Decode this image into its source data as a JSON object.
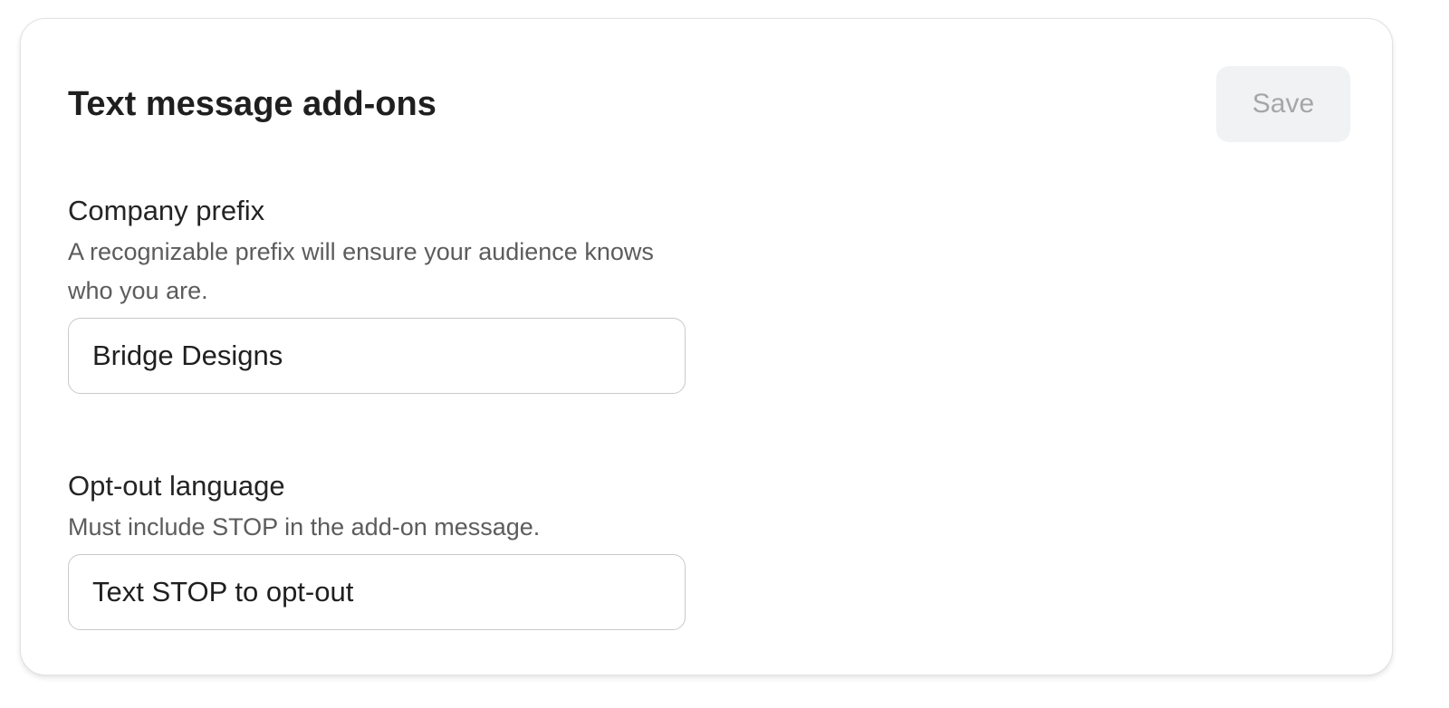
{
  "card": {
    "title": "Text message add-ons",
    "save_label": "Save"
  },
  "company_prefix": {
    "label": "Company prefix",
    "help": "A recognizable prefix will ensure your audience knows who you are.",
    "value": "Bridge Designs"
  },
  "opt_out": {
    "label": "Opt-out language",
    "help": "Must include STOP in the add-on message.",
    "value": "Text STOP to opt-out"
  },
  "colors": {
    "title_text": "#1f1f1f",
    "help_text": "#5c5c5c",
    "save_button_bg": "#f1f2f3",
    "save_button_text": "#a6a6a6",
    "input_border": "#c9c9cc"
  }
}
